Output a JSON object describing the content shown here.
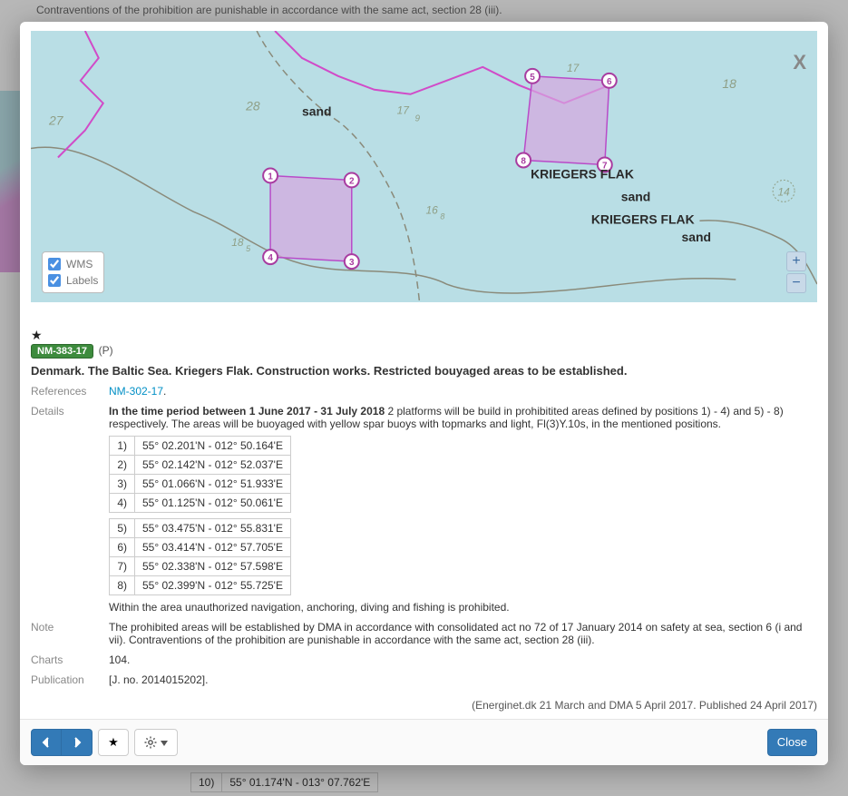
{
  "bg": {
    "top_line": "Contraventions of the prohibition are punishable in accordance with the same act, section 28 (iii).",
    "row_coord": "55° 01.174'N - 013° 07.762'E",
    "row_idx": "10)"
  },
  "modal": {
    "close_label": "X",
    "layers": {
      "wms": "WMS",
      "labels": "Labels"
    },
    "zoom": {
      "in": "+",
      "out": "−"
    },
    "star": "★",
    "badge": "NM-383-17",
    "psuffix": "(P)",
    "title": "Denmark. The Baltic Sea. Kriegers Flak. Construction works. Restricted bouyaged areas to be established.",
    "fields": {
      "references_label": "References",
      "references_link": "NM-302-17",
      "references_dot": ".",
      "details_label": "Details",
      "details_bold": "In the time period between 1 June 2017 - 31 July 2018",
      "details_rest": " 2 platforms will be build in prohibitited areas defined by positions 1) - 4) and 5) - 8) respectively. The areas will be buoyaged with yellow spar buoys with topmarks and light, Fl(3)Y.10s, in the mentioned positions.",
      "table1": [
        {
          "idx": "1)",
          "coord": "55° 02.201'N - 012° 50.164'E"
        },
        {
          "idx": "2)",
          "coord": "55° 02.142'N - 012° 52.037'E"
        },
        {
          "idx": "3)",
          "coord": "55° 01.066'N - 012° 51.933'E"
        },
        {
          "idx": "4)",
          "coord": "55° 01.125'N - 012° 50.061'E"
        }
      ],
      "table2": [
        {
          "idx": "5)",
          "coord": "55° 03.475'N - 012° 55.831'E"
        },
        {
          "idx": "6)",
          "coord": "55° 03.414'N - 012° 57.705'E"
        },
        {
          "idx": "7)",
          "coord": "55° 02.338'N - 012° 57.598'E"
        },
        {
          "idx": "8)",
          "coord": "55° 02.399'N - 012° 55.725'E"
        }
      ],
      "details_tail": "Within the area unauthorized navigation, anchoring, diving and fishing is prohibited.",
      "note_label": "Note",
      "note_val": "The prohibited areas will be established by DMA in accordance with consolidated act no 72 of 17 January 2014 on safety at sea, section 6 (i and vii). Contraventions of the prohibition are punishable in accordance with the same act, section 28 (iii).",
      "charts_label": "Charts",
      "charts_val": "104.",
      "pub_label": "Publication",
      "pub_val": "[J. no. 2014015202].",
      "source": "(Energinet.dk 21 March and DMA 5 April 2017. Published 24 April 2017)"
    },
    "footer": {
      "close": "Close",
      "star": "★"
    }
  },
  "map": {
    "depths": {
      "d27": "27",
      "d28": "28",
      "d9": "9",
      "d17_top": "17",
      "d17_left": "17",
      "d18": "18",
      "d14": "14",
      "d18_5": "18",
      "d18_5s": "5",
      "d16_8": "16",
      "d16_8s": "8"
    },
    "text": {
      "sand1": "sand",
      "sand2": "sand",
      "sand3": "sand",
      "kf1": "KRIEGERS FLAK",
      "kf2": "KRIEGERS FLAK"
    },
    "markers": [
      "1",
      "2",
      "3",
      "4",
      "5",
      "6",
      "7",
      "8"
    ]
  }
}
